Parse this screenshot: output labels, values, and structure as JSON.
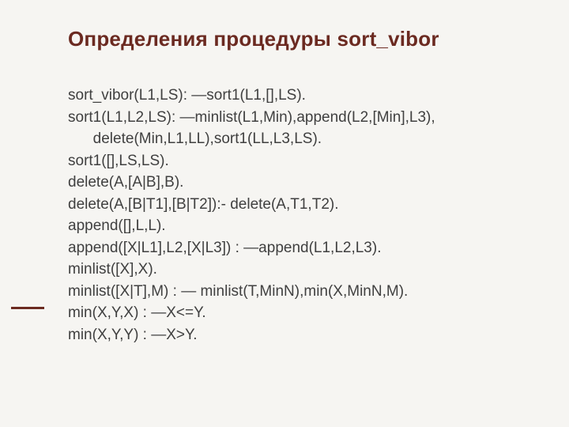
{
  "title": "Определения процедуры sort_vibor",
  "lines": [
    "sort_vibor(L1,LS): —sort1(L1,[],LS).",
    "sort1(L1,L2,LS): —minlist(L1,Min),append(L2,[Min],L3),",
    "      delete(Min,L1,LL),sort1(LL,L3,LS).",
    "sort1([],LS,LS).",
    "delete(A,[A|B],B).",
    "delete(A,[B|T1],[B|T2]):- delete(A,T1,T2).",
    "append([],L,L).",
    "append([X|L1],L2,[X|L3]) : —append(L1,L2,L3).",
    "minlist([X],X).",
    "minlist([X|T],M) : — minlist(T,MinN),min(X,MinN,M).",
    "min(X,Y,X) : —X<=Y.",
    "min(X,Y,Y) : —X>Y."
  ]
}
